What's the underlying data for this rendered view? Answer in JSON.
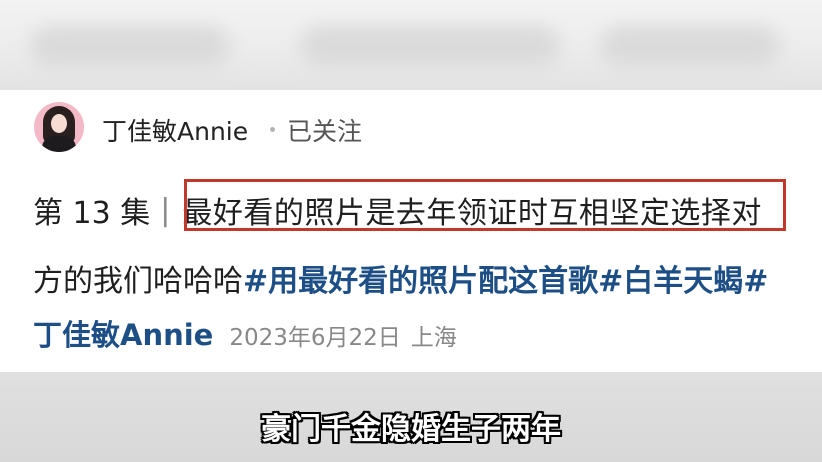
{
  "post": {
    "username": "丁佳敏Annie",
    "follow_status": "已关注",
    "episode_label": "第 13 集",
    "separator": "|",
    "highlighted_text": "最好看的照片是去年领证时互相坚定选择对",
    "continuation_text": "方的我们哈哈哈",
    "hashtags": [
      "#用最好看的照片配这首歌#",
      "白羊天蝎#"
    ],
    "author_name": "丁佳敏Annie",
    "date": "2023年6月22日",
    "location": "上海"
  },
  "video_subtitle": "豪门千金隐婚生子两年",
  "colors": {
    "highlight_border": "#c0392b",
    "hashtag": "#1d4f86",
    "author": "#1d4f86"
  },
  "icons": {
    "avatar": "user-avatar-photo",
    "dot": "separator-dot"
  }
}
